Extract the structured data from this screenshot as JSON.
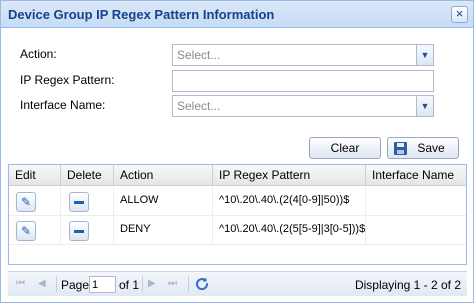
{
  "window": {
    "title": "Device Group IP Regex Pattern Information",
    "close_glyph": "×"
  },
  "form": {
    "action": {
      "label": "Action:",
      "placeholder": "Select..."
    },
    "ip_regex_pattern": {
      "label": "IP Regex Pattern:",
      "value": ""
    },
    "interface_name": {
      "label": "Interface Name:",
      "placeholder": "Select..."
    },
    "combo_trigger_glyph": "▼"
  },
  "buttons": {
    "clear_label": "Clear",
    "save_label": "Save",
    "save_icon": "floppy-disk-icon"
  },
  "grid": {
    "columns": [
      "Edit",
      "Delete",
      "Action",
      "IP Regex Pattern",
      "Interface Name"
    ],
    "rows": [
      {
        "action": "ALLOW",
        "ip_regex_pattern": "^10\\.20\\.40\\.(2(4[0-9]|50))$",
        "interface_name": ""
      },
      {
        "action": "DENY",
        "ip_regex_pattern": "^10\\.20\\.40\\.(2(5[5-9]|3[0-5]))$",
        "interface_name": ""
      }
    ],
    "edit_glyph": "✎"
  },
  "paging": {
    "page_label": "Page",
    "current_page": "1",
    "of_label": "of 1",
    "display_info": "Displaying 1 - 2 of 2",
    "first_glyph": "⏮",
    "prev_glyph": "◀",
    "next_glyph": "▶",
    "last_glyph": "⏭"
  },
  "colors": {
    "title_text": "#15428b",
    "border": "#99bbe8",
    "row_icon": "#1d5fb0"
  }
}
